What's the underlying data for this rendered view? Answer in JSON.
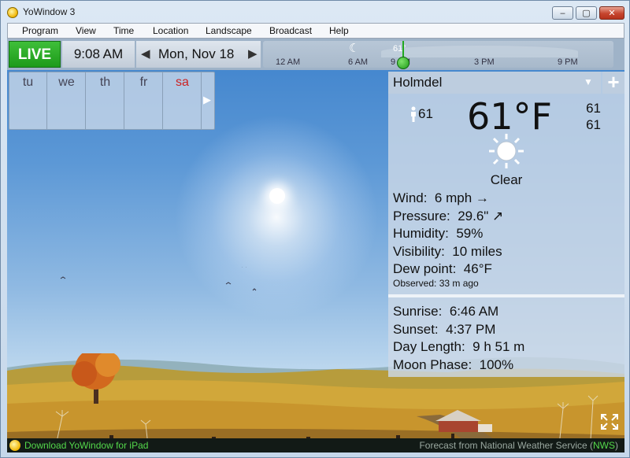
{
  "window": {
    "title": "YoWindow 3",
    "min_label": "‒",
    "max_label": "▢",
    "close_label": "✕"
  },
  "menu": [
    "Program",
    "View",
    "Time",
    "Location",
    "Landscape",
    "Broadcast",
    "Help"
  ],
  "toolbar": {
    "live_label": "LIVE",
    "time": "9:08 AM",
    "date": "Mon, Nov 18",
    "prev_glyph": "◀",
    "next_glyph": "▶"
  },
  "timeline": {
    "labels": [
      "12 AM",
      "6 AM",
      "9 AM",
      "3 PM",
      "9 PM"
    ],
    "current_temp": "61°",
    "moon_glyph": "☾"
  },
  "days": {
    "items": [
      "tu",
      "we",
      "th",
      "fr",
      "sa"
    ],
    "more_glyph": "▶"
  },
  "weather": {
    "location": "Holmdel",
    "dropdown_glyph": "▼",
    "add_glyph": "+",
    "feels_like": "61",
    "temperature": "61°F",
    "high": "61",
    "low": "61",
    "condition": "Clear",
    "wind_label": "Wind:",
    "wind_value": "6 mph →",
    "pressure_label": "Pressure:",
    "pressure_value": "29.6\" ↗",
    "humidity_label": "Humidity:",
    "humidity_value": "59%",
    "visibility_label": "Visibility:",
    "visibility_value": "10 miles",
    "dew_label": "Dew point:",
    "dew_value": "46°F",
    "observed": "Observed:  33 m ago"
  },
  "astro": {
    "sunrise_label": "Sunrise:",
    "sunrise_value": "6:46 AM",
    "sunset_label": "Sunset:",
    "sunset_value": "4:37 PM",
    "daylength_label": "Day Length:",
    "daylength_value": "9 h 51 m",
    "moon_label": "Moon Phase:",
    "moon_value": "100%"
  },
  "status": {
    "download_link": "Download YoWindow for iPad",
    "forecast_prefix": "Forecast from National Weather Service (",
    "forecast_source": "NWS",
    "forecast_suffix": ")"
  },
  "colors": {
    "live_green": "#1d9a1a",
    "sky_top": "#3e82cc",
    "status_green": "#54d94b",
    "weekend_red": "#c22222"
  },
  "icons": {
    "condition": "sun-icon",
    "feels_like": "person-icon",
    "fullscreen": "expand-icon"
  }
}
